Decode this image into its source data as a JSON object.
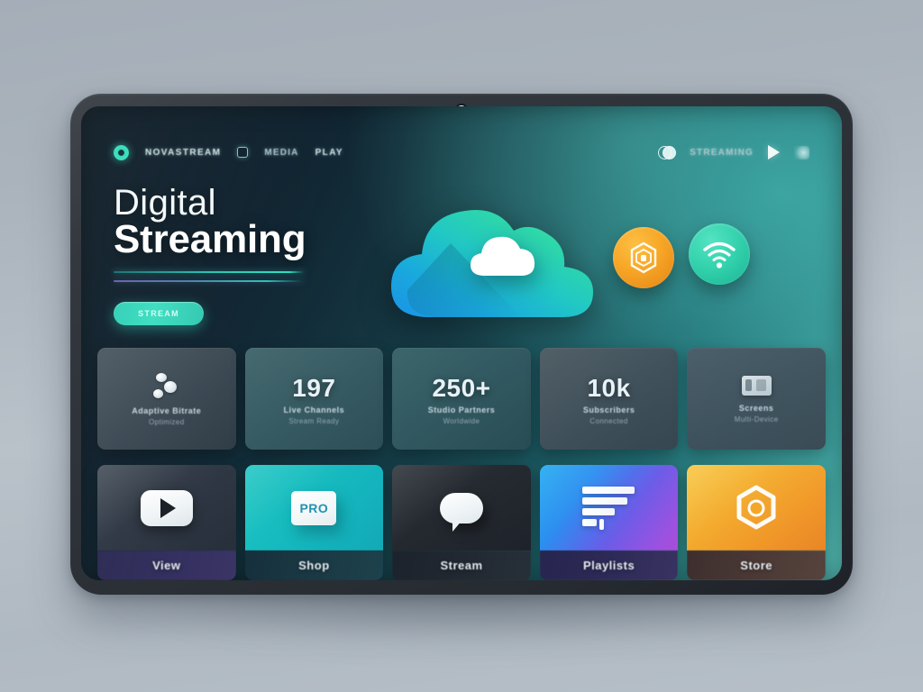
{
  "device": {
    "kind": "tablet",
    "camera_icon": "camera-dot",
    "bezel_color": "#2c3137"
  },
  "background": {
    "top_color": "#a5aeb8",
    "bottom_color": "#b6bfc7"
  },
  "screen": {
    "gradient_from": "#0d1b25",
    "gradient_to": "#4dbdb4"
  },
  "navbar": {
    "logo_icon": "ring-logo-icon",
    "brand": "NOVASTREAM",
    "grid_icon": "square-icon",
    "items": [
      {
        "label": "MEDIA"
      },
      {
        "label": "PLAY"
      }
    ],
    "right": {
      "account_icon": "circles-icon",
      "account_label": "STREAMING",
      "play_icon": "play-icon",
      "menu_icon": "menu-glyph-icon"
    }
  },
  "hero": {
    "title_line1": "Digital",
    "title_line2": "Streaming",
    "rule_top_color": "#33e0c2",
    "rule_bottom_color": "#6b5ea8",
    "cta_label": "STREAM",
    "cta_color": "#32c8b0"
  },
  "hero_art": {
    "cloud_icon": "cloud-icon",
    "cloud_gradient_from": "#1fa4e8",
    "cloud_gradient_mid": "#24c9c0",
    "cloud_gradient_to": "#6fe08a",
    "inner_cloud_icon": "small-cloud-icon",
    "badges": [
      {
        "icon": "hexagon-gear-icon",
        "color": "#f7a827"
      },
      {
        "icon": "wifi-icon",
        "color": "#34d3ae"
      }
    ]
  },
  "stats": [
    {
      "icon": "dots-cluster-icon",
      "value": "",
      "label": "Adaptive Bitrate",
      "sub": "Optimized"
    },
    {
      "icon": "",
      "value": "197",
      "label": "Live Channels",
      "sub": "Stream Ready"
    },
    {
      "icon": "",
      "value": "250+",
      "label": "Studio Partners",
      "sub": "Worldwide"
    },
    {
      "icon": "",
      "value": "10k",
      "label": "Subscribers",
      "sub": "Connected"
    },
    {
      "icon": "monitor-icon",
      "value": "",
      "label": "Screens",
      "sub": "Multi-Device"
    }
  ],
  "tiles": [
    {
      "icon": "play-icon",
      "label": "View",
      "badge": ""
    },
    {
      "icon": "pro-badge-icon",
      "label": "Shop",
      "badge": "PRO"
    },
    {
      "icon": "chat-bubble-icon",
      "label": "Stream",
      "badge": ""
    },
    {
      "icon": "list-bars-icon",
      "label": "Playlists",
      "badge": ""
    },
    {
      "icon": "hexagon-circle-icon",
      "label": "Store",
      "badge": ""
    }
  ]
}
